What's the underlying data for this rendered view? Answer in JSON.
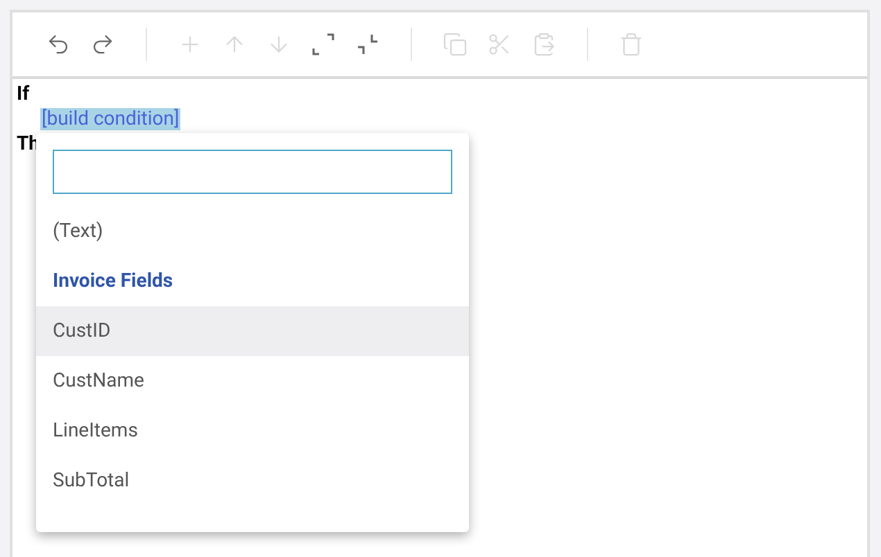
{
  "toolbar": [
    {
      "kind": "undo",
      "disabled": false
    },
    {
      "kind": "redo",
      "disabled": false
    },
    {
      "kind": "divider"
    },
    {
      "kind": "add",
      "disabled": true
    },
    {
      "kind": "up",
      "disabled": true
    },
    {
      "kind": "down",
      "disabled": true
    },
    {
      "kind": "expand",
      "disabled": false
    },
    {
      "kind": "collapse",
      "disabled": false
    },
    {
      "kind": "divider"
    },
    {
      "kind": "copy",
      "disabled": true
    },
    {
      "kind": "cut",
      "disabled": true
    },
    {
      "kind": "paste",
      "disabled": true
    },
    {
      "kind": "divider"
    },
    {
      "kind": "delete",
      "disabled": true
    }
  ],
  "editor": {
    "if_label": "If",
    "condition": "[build condition]",
    "then_label": "Th"
  },
  "dropdown": {
    "items": [
      {
        "kind": "option",
        "label": "(Text)",
        "selected": false
      },
      {
        "kind": "group",
        "label": "Invoice Fields"
      },
      {
        "kind": "option",
        "label": "CustID",
        "selected": true
      },
      {
        "kind": "option",
        "label": "CustName",
        "selected": false
      },
      {
        "kind": "option",
        "label": "LineItems",
        "selected": false
      },
      {
        "kind": "option",
        "label": "SubTotal",
        "selected": false
      }
    ]
  }
}
